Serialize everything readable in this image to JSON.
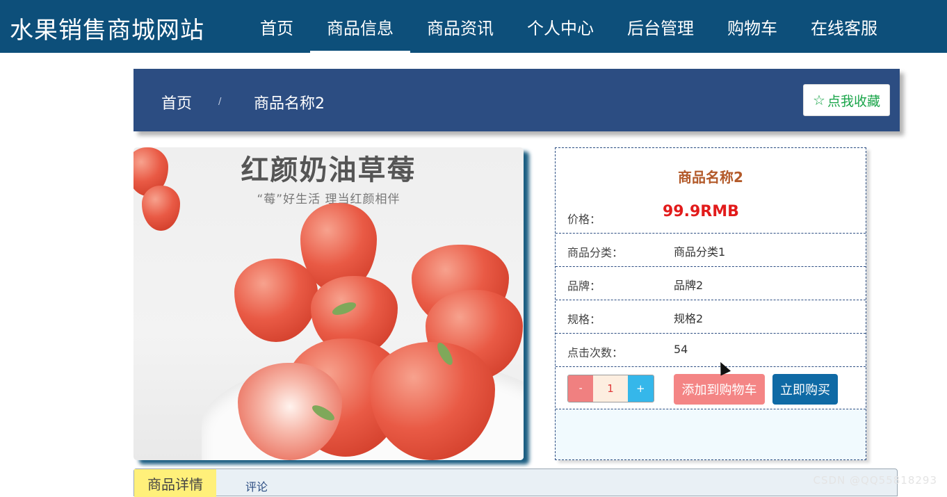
{
  "header": {
    "site_title": "水果销售商城网站",
    "nav": [
      {
        "label": "首页"
      },
      {
        "label": "商品信息"
      },
      {
        "label": "商品资讯"
      },
      {
        "label": "个人中心"
      },
      {
        "label": "后台管理"
      },
      {
        "label": "购物车"
      },
      {
        "label": "在线客服"
      }
    ],
    "active_nav": "商品信息"
  },
  "breadcrumb": {
    "home": "首页",
    "separator": "/",
    "current": "商品名称2",
    "favorite_label": "点我收藏",
    "favorite_icon": "star-outline-icon"
  },
  "product_image": {
    "title": "红颜奶油草莓",
    "subtitle": "“莓”好生活 理当红颜相伴"
  },
  "product": {
    "name": "商品名称2",
    "price_label": "价格：",
    "price": "99.9RMB",
    "rows": [
      {
        "label": "商品分类：",
        "value": "商品分类1"
      },
      {
        "label": "品牌：",
        "value": "品牌2"
      },
      {
        "label": "规格：",
        "value": "规格2"
      },
      {
        "label": "点击次数：",
        "value": "54"
      }
    ],
    "quantity": {
      "minus": "-",
      "value": "1",
      "plus": "+"
    },
    "add_to_cart": "添加到购物车",
    "buy_now": "立即购买"
  },
  "tabs": {
    "detail": "商品详情",
    "comment": "评论"
  },
  "watermark": "CSDN @QQ55818293",
  "colors": {
    "header_bg": "#0d4f7a",
    "breadcrumb_bg": "#2c4d82",
    "price": "#e21b1b",
    "add_to_cart": "#f48585",
    "buy_now": "#0f6aa5"
  }
}
